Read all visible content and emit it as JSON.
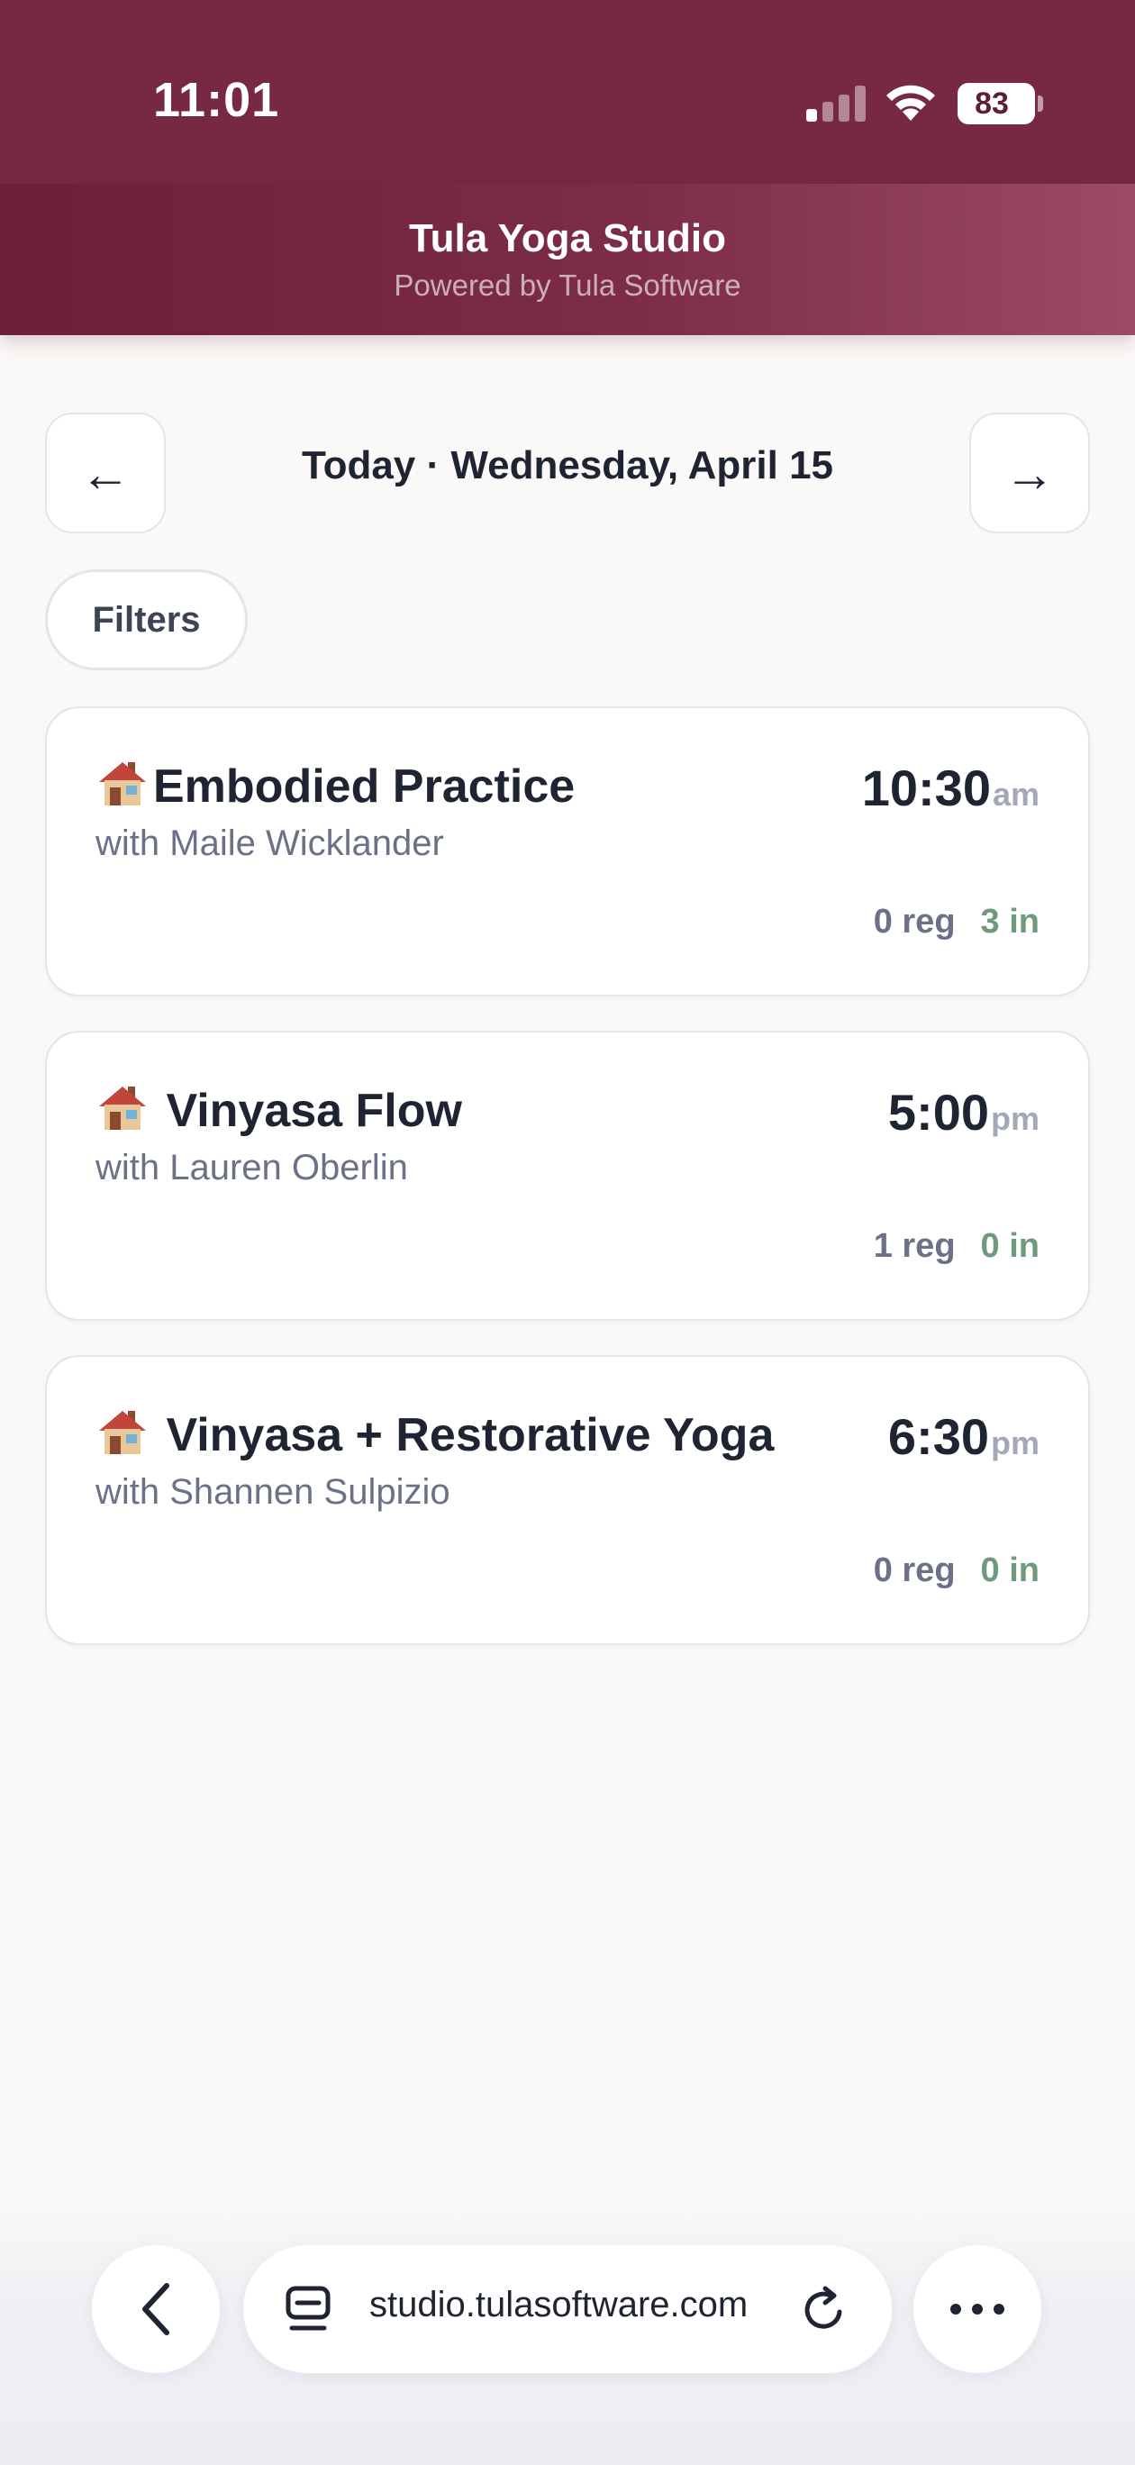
{
  "status_bar": {
    "time": "11:01",
    "battery": "83",
    "icons": [
      "signal-icon",
      "wifi-icon",
      "battery-icon"
    ]
  },
  "header": {
    "title": "Tula Yoga Studio",
    "subtitle": "Powered by Tula Software"
  },
  "date_nav": {
    "prev_arrow": "←",
    "label": "Today · Wednesday, April 15",
    "next_arrow": "→"
  },
  "filters": {
    "label": "Filters"
  },
  "classes": [
    {
      "name": "Embodied Practice",
      "instructor": "with Maile Wicklander",
      "time": "10:30",
      "ampm": "am",
      "reg": "0 reg",
      "checked_in": "3 in",
      "icon": "house-icon"
    },
    {
      "name": "Vinyasa Flow",
      "instructor": "with Lauren Oberlin",
      "time": "5:00",
      "ampm": "pm",
      "reg": "1 reg",
      "checked_in": "0 in",
      "icon": "house-icon"
    },
    {
      "name": "Vinyasa + Restorative Yoga",
      "instructor": "with Shannen Sulpizio",
      "time": "6:30",
      "ampm": "pm",
      "reg": "0 reg",
      "checked_in": "0 in",
      "icon": "house-icon"
    }
  ],
  "browser": {
    "url": "studio.tulasoftware.com",
    "icons": [
      "back-chevron-icon",
      "tabs-icon",
      "reload-icon",
      "more-icon"
    ]
  },
  "colors": {
    "brand": "#772842",
    "checked_in_green": "#6f9a7b",
    "muted_text": "#6b7287"
  }
}
